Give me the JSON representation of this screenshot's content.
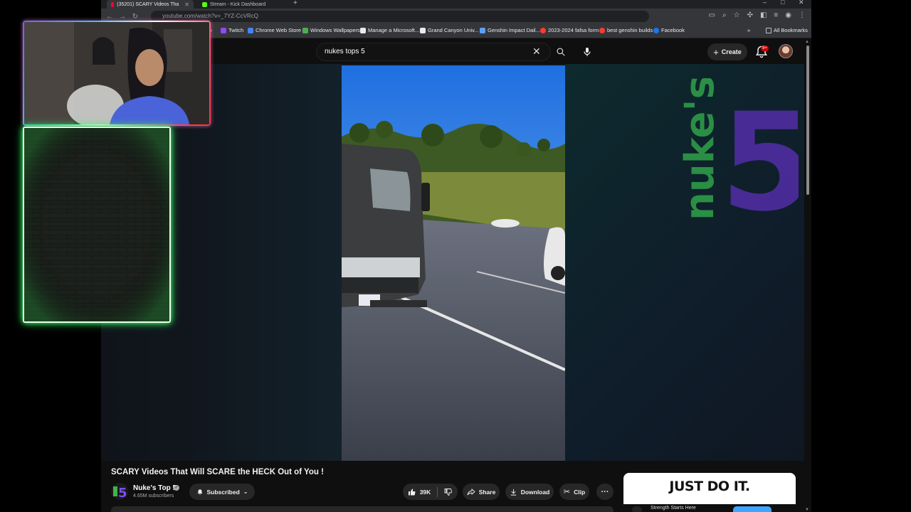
{
  "browser": {
    "tabs": [
      {
        "label": "(35201) SCARY Videos Tha",
        "favicon_color": "#ff0033",
        "active": true
      },
      {
        "label": "Stream - Kick Dashboard",
        "favicon_color": "#53fc18",
        "active": false
      }
    ],
    "url": "youtube.com/watch?v=_7YZ-CcVRcQ",
    "bookmarks": [
      {
        "label": "Twitch",
        "icon_color": "#9146ff"
      },
      {
        "label": "Chrome Web Store",
        "icon_color": "#4285f4"
      },
      {
        "label": "Windows Wallpapers",
        "icon_color": "#4caf50"
      },
      {
        "label": "Manage a Microsoft...",
        "icon_color": "#e8eaed"
      },
      {
        "label": "Grand Canyon Univ...",
        "icon_color": "#e8eaed"
      },
      {
        "label": "Genshin Impact Dail...",
        "icon_color": "#5aa0ff"
      },
      {
        "label": "2023-2024 fafsa form",
        "icon_color": "#ff3b30"
      },
      {
        "label": "best genshin builds",
        "icon_color": "#ff3b30"
      },
      {
        "label": "Facebook",
        "icon_color": "#1877f2"
      }
    ],
    "all_bookmarks_label": "All Bookmarks"
  },
  "youtube": {
    "search_query": "nukes tops 5",
    "create_label": "Create",
    "notification_badge": "9+"
  },
  "video": {
    "title": "SCARY Videos That Will SCARE the HECK Out of You !",
    "channel_name": "Nuke's Top 5",
    "subscriber_count": "4.65M subscribers",
    "subscribe_label": "Subscribed",
    "like_count": "39K",
    "share_label": "Share",
    "download_label": "Download",
    "clip_label": "Clip"
  },
  "ad": {
    "headline": "JUST DO IT.",
    "subtext": "Strength Starts Here"
  },
  "colors": {
    "accent_red": "#ff0033",
    "overlay_green": "#33ff66",
    "page_background": "#0f0f0f"
  }
}
